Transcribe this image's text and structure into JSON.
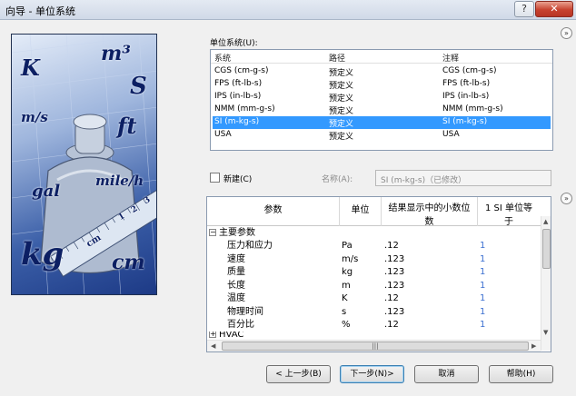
{
  "window": {
    "title": "向导 - 单位系统",
    "help_glyph": "?",
    "close_glyph": "✕"
  },
  "side_image": {
    "units": [
      "K",
      "m³",
      "S",
      "m/s",
      "ft",
      "gal",
      "mile/h",
      "kg",
      "cm"
    ],
    "ruler_marks": [
      "1",
      "2",
      "3",
      "cm"
    ]
  },
  "unit_systems": {
    "label": "单位系统(U):",
    "columns": [
      "系统",
      "路径",
      "注释"
    ],
    "rows": [
      {
        "system": "CGS (cm-g-s)",
        "path": "预定义",
        "note": "CGS (cm-g-s)",
        "selected": false
      },
      {
        "system": "FPS (ft-lb-s)",
        "path": "预定义",
        "note": "FPS (ft-lb-s)",
        "selected": false
      },
      {
        "system": "IPS (in-lb-s)",
        "path": "预定义",
        "note": "IPS (in-lb-s)",
        "selected": false
      },
      {
        "system": "NMM (mm-g-s)",
        "path": "预定义",
        "note": "NMM (mm-g-s)",
        "selected": false
      },
      {
        "system": "SI (m-kg-s)",
        "path": "预定义",
        "note": "SI (m-kg-s)",
        "selected": true
      },
      {
        "system": "USA",
        "path": "预定义",
        "note": "USA",
        "selected": false
      }
    ]
  },
  "new_option": {
    "label": "新建(C)",
    "checked": false
  },
  "name_field": {
    "label": "名称(A):",
    "value": "SI (m-kg-s)（已修改）"
  },
  "parameters": {
    "headers": {
      "param": "参数",
      "unit": "单位",
      "decimals_1": "结果显示中的小数位",
      "decimals_2": "数",
      "si_1": "1 SI 单位等",
      "si_2": "于"
    },
    "group_main": "主要参数",
    "group_next": "HVAC",
    "rows": [
      {
        "name": "压力和应力",
        "unit": "Pa",
        "decimals": ".12",
        "si": "1"
      },
      {
        "name": "速度",
        "unit": "m/s",
        "decimals": ".123",
        "si": "1"
      },
      {
        "name": "质量",
        "unit": "kg",
        "decimals": ".123",
        "si": "1"
      },
      {
        "name": "长度",
        "unit": "m",
        "decimals": ".123",
        "si": "1"
      },
      {
        "name": "温度",
        "unit": "K",
        "decimals": ".12",
        "si": "1"
      },
      {
        "name": "物理时间",
        "unit": "s",
        "decimals": ".123",
        "si": "1"
      },
      {
        "name": "百分比",
        "unit": "%",
        "decimals": ".12",
        "si": "1"
      }
    ]
  },
  "buttons": {
    "back": "< 上一步(B)",
    "next": "下一步(N)>",
    "cancel": "取消",
    "help": "帮助(H)"
  },
  "colors": {
    "selection": "#3399ff",
    "si_value": "#3a6fd0"
  }
}
